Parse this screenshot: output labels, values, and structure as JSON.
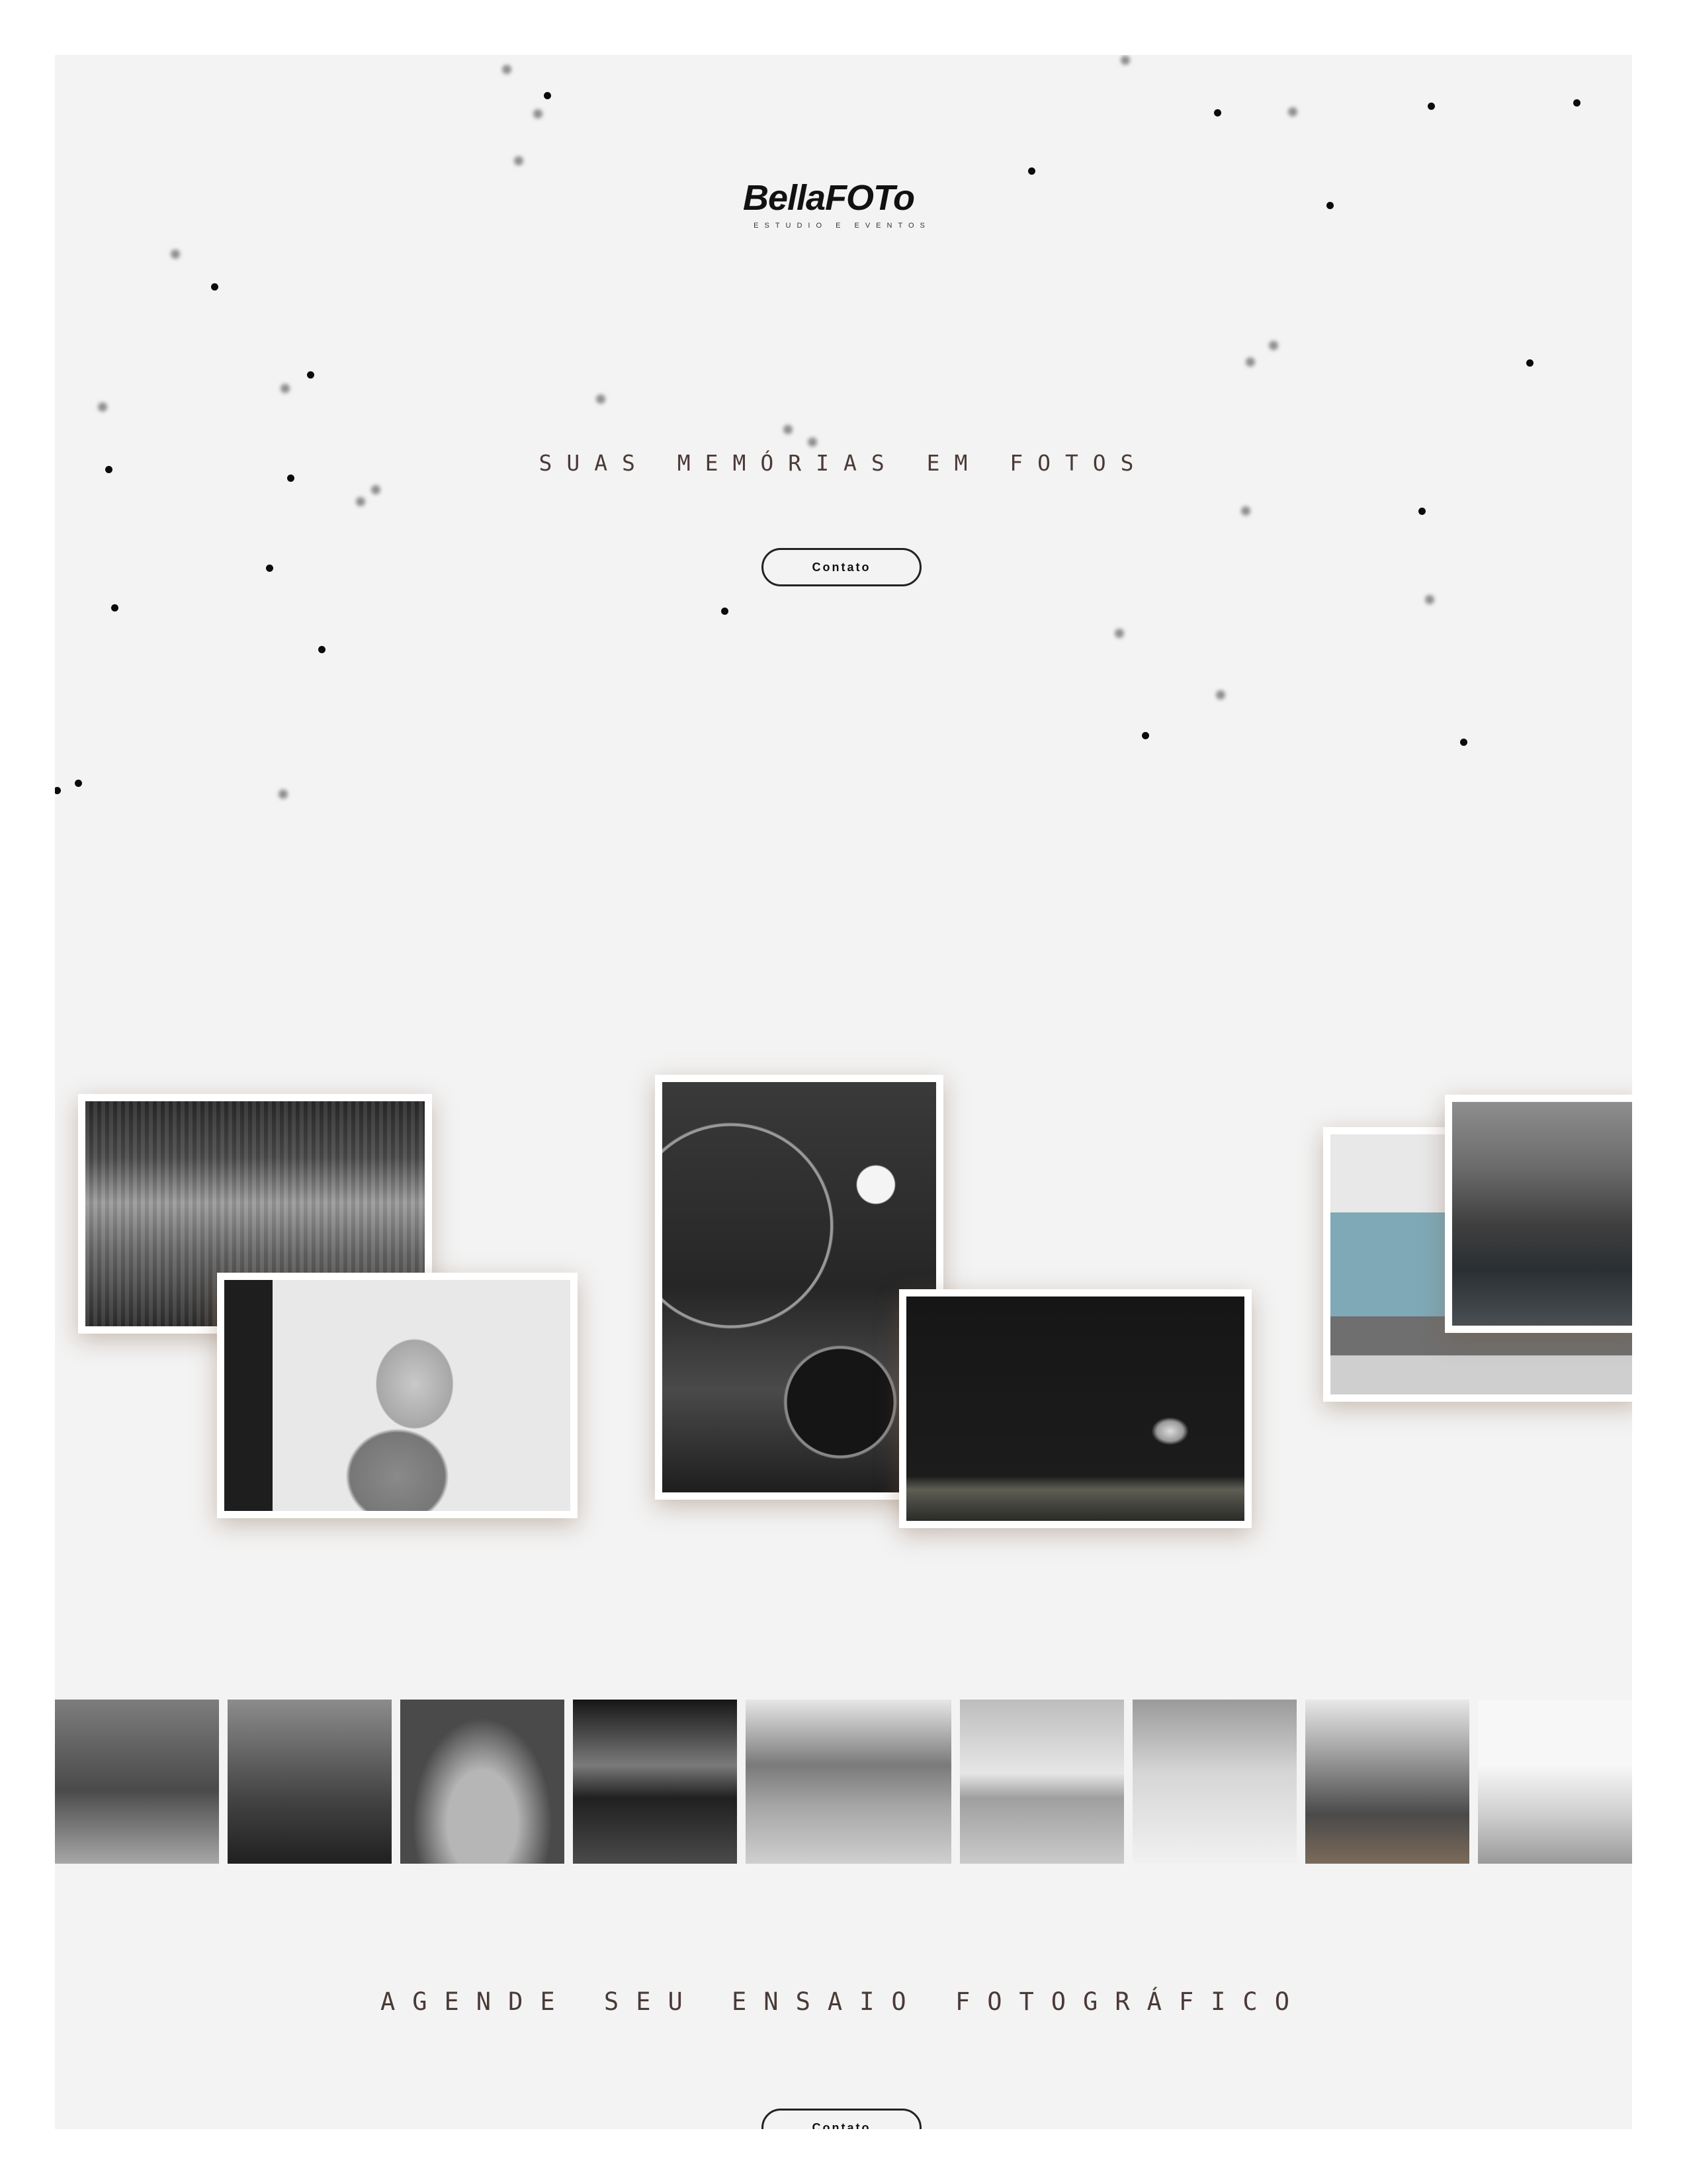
{
  "brand": {
    "logo_text": "BellaFOTo",
    "logo_subtitle": "ESTUDIO E EVENTOS"
  },
  "hero": {
    "tagline": "SUAS MEMÓRIAS EM FOTOS",
    "cta_label": "Contato"
  },
  "gallery": {
    "photos": [
      {
        "name": "cafe-chairs-photo"
      },
      {
        "name": "doll-photo"
      },
      {
        "name": "clock-tower-photo"
      },
      {
        "name": "dark-street-photo"
      },
      {
        "name": "storefront-photo"
      },
      {
        "name": "eiffel-tower-photo"
      }
    ]
  },
  "strip": {
    "images": [
      "valley-photo",
      "mountains-photo",
      "desert-spiral-photo",
      "reflection-photo",
      "lake-boat-photo",
      "sunset-beach-photo",
      "palm-beach-photo",
      "boat-lake-photo",
      "flower-field-photo"
    ]
  },
  "booking": {
    "tagline": "AGENDE SEU ENSAIO FOTOGRÁFICO",
    "cta_label": "Contato"
  },
  "colors": {
    "page_background": "#f3f3f3",
    "heading_text": "#4a3a36",
    "particle": "#0b0b0b"
  }
}
